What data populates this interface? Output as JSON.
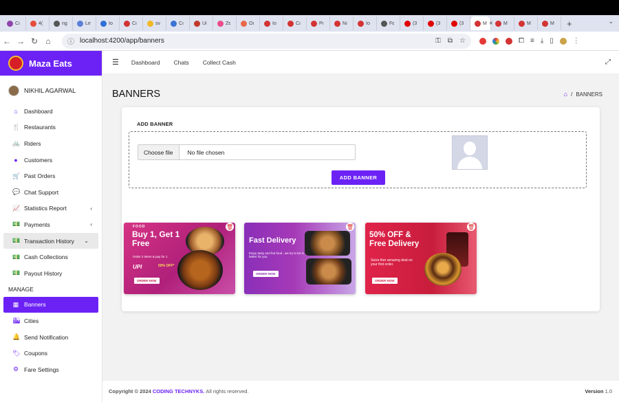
{
  "browser": {
    "url": "localhost:4200/app/banners",
    "tabs": [
      {
        "label": "Cı",
        "color": "#8e44ad"
      },
      {
        "label": "4(",
        "color": "#e74c3c"
      },
      {
        "label": "ng",
        "color": "#555555"
      },
      {
        "label": "Le",
        "color": "#5a7fd6"
      },
      {
        "label": "Io",
        "color": "#2f6fd6"
      },
      {
        "label": "Cı",
        "color": "#d33333"
      },
      {
        "label": "sv",
        "color": "#f1b824"
      },
      {
        "label": "Cı",
        "color": "#3b73d3"
      },
      {
        "label": "Ui",
        "color": "#c0392b"
      },
      {
        "label": "Zε",
        "color": "#ea4c89"
      },
      {
        "label": "Oı",
        "color": "#e8684a"
      },
      {
        "label": "Io",
        "color": "#d33333"
      },
      {
        "label": "Cı",
        "color": "#d33333"
      },
      {
        "label": "Pı",
        "color": "#d33333"
      },
      {
        "label": "Nı",
        "color": "#d33333"
      },
      {
        "label": "Io",
        "color": "#d33333"
      },
      {
        "label": "Fε",
        "color": "#555555"
      },
      {
        "label": "(3",
        "color": "#e00000"
      },
      {
        "label": "(3",
        "color": "#e00000"
      },
      {
        "label": "(3",
        "color": "#e00000"
      },
      {
        "label": "M",
        "color": "#d33333",
        "active": true
      },
      {
        "label": "M",
        "color": "#d33333"
      },
      {
        "label": "M",
        "color": "#d33333"
      },
      {
        "label": "M",
        "color": "#d33333"
      }
    ]
  },
  "brand": {
    "name": "Maza Eats"
  },
  "user": {
    "name": "NIKHIL AGARWAL"
  },
  "sidebar": {
    "items": [
      {
        "label": "Dashboard",
        "icon": "home-icon",
        "glyph": "⌂"
      },
      {
        "label": "Restaurants",
        "icon": "utensils-icon",
        "glyph": "🍴"
      },
      {
        "label": "Riders",
        "icon": "bicycle-icon",
        "glyph": "🚲"
      },
      {
        "label": "Customers",
        "icon": "user-icon",
        "glyph": "●"
      },
      {
        "label": "Past Orders",
        "icon": "cart-icon",
        "glyph": "🛒"
      },
      {
        "label": "Chat Support",
        "icon": "chat-icon",
        "glyph": "💬"
      },
      {
        "label": "Statistics Report",
        "icon": "chart-icon",
        "glyph": "📈",
        "chevron": "‹"
      },
      {
        "label": "Payments",
        "icon": "money-icon",
        "glyph": "💵",
        "chevron": "‹"
      },
      {
        "label": "Transaction History",
        "icon": "money-icon",
        "glyph": "💵",
        "chevron": "⌄",
        "highlight": true
      },
      {
        "label": "Cash Collections",
        "icon": "money-icon",
        "glyph": "💵"
      },
      {
        "label": "Payout History",
        "icon": "money-icon",
        "glyph": "💵"
      }
    ],
    "section": "MANAGE",
    "manage_items": [
      {
        "label": "Banners",
        "icon": "table-icon",
        "glyph": "▦",
        "active": true
      },
      {
        "label": "Cities",
        "icon": "city-icon",
        "glyph": "🏙"
      },
      {
        "label": "Send Notification",
        "icon": "bell-icon",
        "glyph": "🔔"
      },
      {
        "label": "Coupons",
        "icon": "tag-icon",
        "glyph": "🏷"
      },
      {
        "label": "Fare Settings",
        "icon": "gear-icon",
        "glyph": "⚙"
      }
    ]
  },
  "header": {
    "links": [
      "Dashboard",
      "Chats",
      "Collect Cash"
    ]
  },
  "page": {
    "title": "BANNERS",
    "breadcrumb": "BANNERS"
  },
  "add_banner": {
    "title": "ADD BANNER",
    "choose_file": "Choose file",
    "file_status": "No file chosen",
    "button": "ADD BANNER"
  },
  "banners": [
    {
      "tag": "FOOD",
      "headline": "Buy 1, Get 1 Free",
      "sub": "Order 2 Items & pay for 1",
      "upi": "UPI",
      "offer": "50% OFF*",
      "cta": "ORDER NOW"
    },
    {
      "headline": "Fast Delivery",
      "sub": "Enjoy tasty and hot food , we try to be is better for you",
      "cta": "ORDER NOW"
    },
    {
      "headline": "50% OFF & Free Delivery",
      "sub": "Seize ther amazing deal on your first order.",
      "cta": "ORDER NOW"
    }
  ],
  "footer": {
    "copyright_prefix": "Copyright © 2024",
    "company": "CODING TECHNYKS.",
    "rights": "All rights reserved.",
    "version_label": "Version",
    "version": "1.0"
  }
}
